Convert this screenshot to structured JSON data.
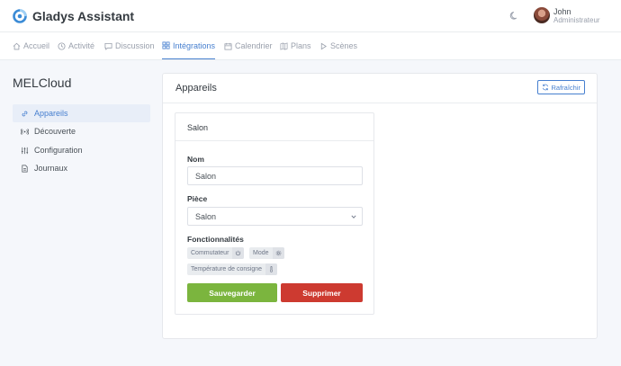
{
  "app": {
    "title": "Gladys Assistant"
  },
  "user": {
    "name": "John",
    "role": "Administrateur"
  },
  "nav": {
    "accueil": "Accueil",
    "activite": "Activité",
    "discussion": "Discussion",
    "integrations": "Intégrations",
    "calendrier": "Calendrier",
    "plans": "Plans",
    "scenes": "Scènes"
  },
  "sidebar": {
    "title": "MELCloud",
    "items": [
      "Appareils",
      "Découverte",
      "Configuration",
      "Journaux"
    ]
  },
  "main": {
    "title": "Appareils",
    "refresh_label": "Rafraîchir"
  },
  "device": {
    "header_name": "Salon",
    "name_label": "Nom",
    "name_value": "Salon",
    "room_label": "Pièce",
    "room_value": "Salon",
    "features_label": "Fonctionnalités",
    "features": [
      "Commutateur",
      "Mode",
      "Température de consigne"
    ],
    "save_label": "Sauvegarder",
    "delete_label": "Supprimer"
  },
  "colors": {
    "accent": "#467fcf",
    "save": "#7bb53e",
    "delete": "#cd3a30"
  }
}
